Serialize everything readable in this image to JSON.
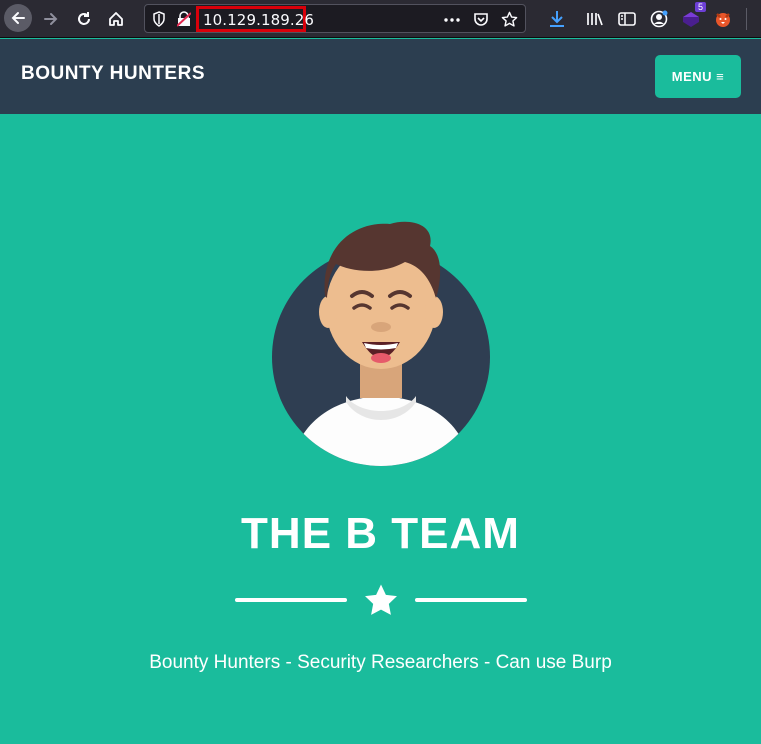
{
  "browser": {
    "url": "10.129.189.26",
    "icons": [
      "back-arrow-icon",
      "forward-arrow-icon",
      "reload-icon",
      "home-icon",
      "shield-icon",
      "insecure-lock-icon",
      "more-icon",
      "pocket-icon",
      "bookmark-star-icon",
      "download-icon",
      "library-icon",
      "sidebar-icon",
      "account-icon",
      "extension-icon",
      "foxyproxy-icon",
      "hamburger-icon"
    ],
    "extension_badge": "5"
  },
  "site": {
    "brand": "BOUNTY HUNTERS",
    "menu_label": "MENU ≡",
    "title": "THE B TEAM",
    "subtitle": "Bounty Hunters - Security Researchers - Can use Burp"
  },
  "colors": {
    "primary": "#1abc9c",
    "nav": "#2c3e50",
    "chrome": "#2b2a33",
    "highlight": "#d9000a"
  }
}
